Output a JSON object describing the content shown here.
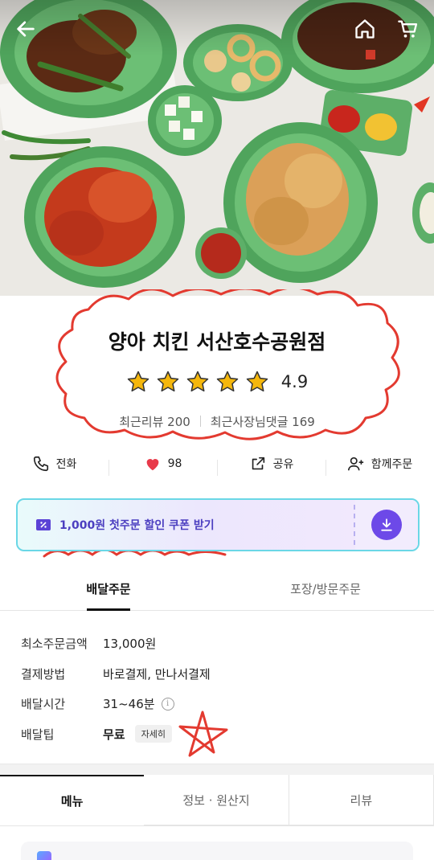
{
  "store": {
    "name": "양아 치킨 서산호수공원점",
    "rating": "4.9",
    "recent_reviews": "최근리뷰 200",
    "owner_replies": "최근사장님댓글 169"
  },
  "actions": {
    "call": "전화",
    "likes": "98",
    "share": "공유",
    "group_order": "함께주문"
  },
  "coupon": {
    "text": "1,000원 첫주문 할인 쿠폰 받기"
  },
  "order_tabs": {
    "delivery": "배달주문",
    "pickup": "포장/방문주문"
  },
  "delivery_info": {
    "min_order_label": "최소주문금액",
    "min_order_value": "13,000원",
    "payment_label": "결제방법",
    "payment_value": "바로결제, 만나서결제",
    "time_label": "배달시간",
    "time_value": "31~46분",
    "tip_label": "배달팁",
    "tip_value": "무료",
    "tip_detail": "자세히"
  },
  "section_tabs": {
    "menu": "메뉴",
    "info": "정보 · 원산지",
    "review": "리뷰"
  },
  "colors": {
    "accent_purple": "#6d49e8",
    "coupon_border": "#6ad7e6",
    "heart": "#e83a4a",
    "star": "#f5b70c",
    "scribble": "#e33a30"
  },
  "icons": [
    "back-arrow-icon",
    "home-icon",
    "cart-icon",
    "phone-icon",
    "heart-icon",
    "share-icon",
    "add-person-icon",
    "coupon-icon",
    "download-icon",
    "info-icon",
    "star-icon"
  ]
}
